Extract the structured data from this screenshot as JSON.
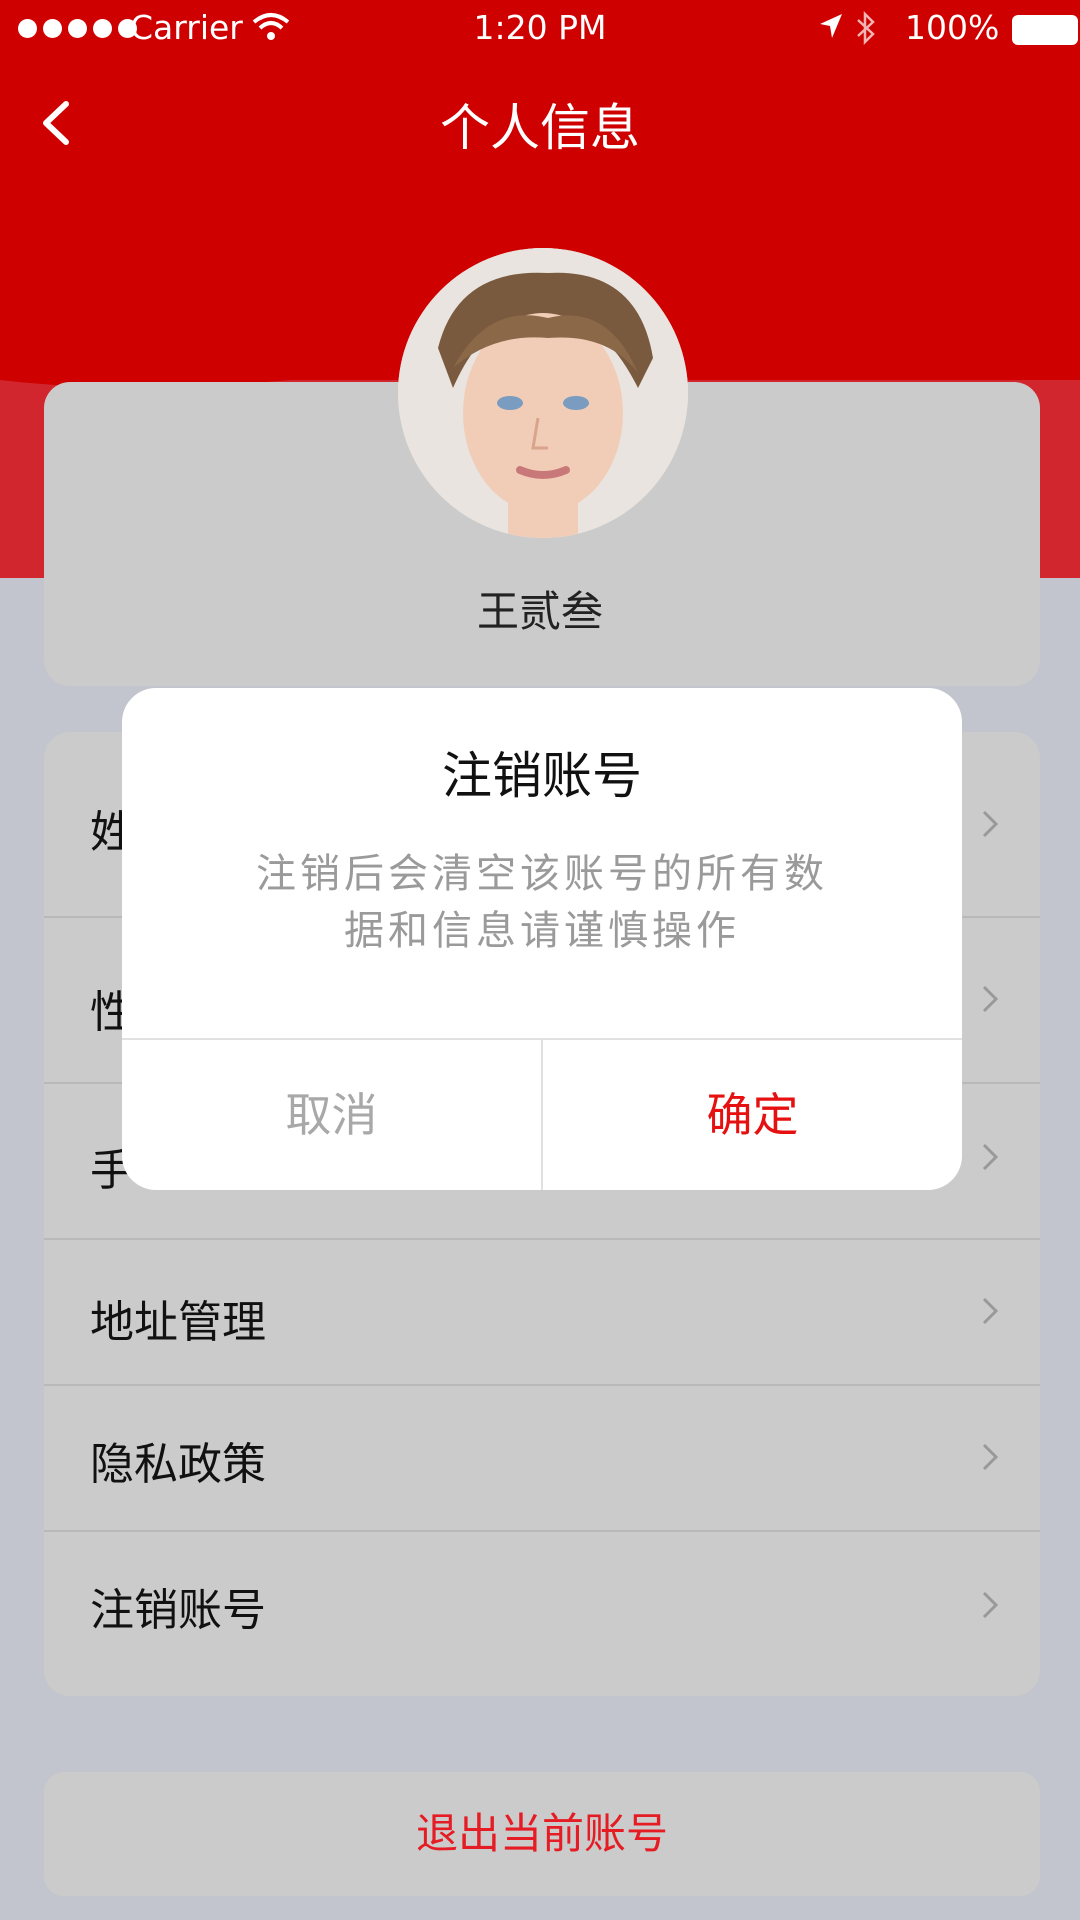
{
  "status_bar": {
    "carrier": "Carrier",
    "time": "1:20 PM",
    "battery": "100%",
    "icons": [
      "signal-dots-icon",
      "wifi-icon",
      "location-arrow-icon",
      "bluetooth-icon",
      "battery-icon"
    ]
  },
  "nav": {
    "back_icon": "chevron-left-icon",
    "title": "个人信息"
  },
  "profile": {
    "name": "王贰叁"
  },
  "menu": {
    "items": [
      {
        "label": "姓"
      },
      {
        "label": "性"
      },
      {
        "label": "手"
      },
      {
        "label": "地址管理"
      },
      {
        "label": "隐私政策"
      },
      {
        "label": "注销账号"
      }
    ]
  },
  "logout": {
    "label": "退出当前账号"
  },
  "dialog": {
    "title": "注销账号",
    "message_line1": "注销后会清空该账号的所有数",
    "message_line2": "据和信息请谨慎操作",
    "cancel_label": "取消",
    "confirm_label": "确定"
  },
  "colors": {
    "header_red": "#cf0000",
    "dialog_confirm": "#e5100f",
    "logout_red": "#e51c23",
    "page_bg": "#c2c5cd"
  }
}
